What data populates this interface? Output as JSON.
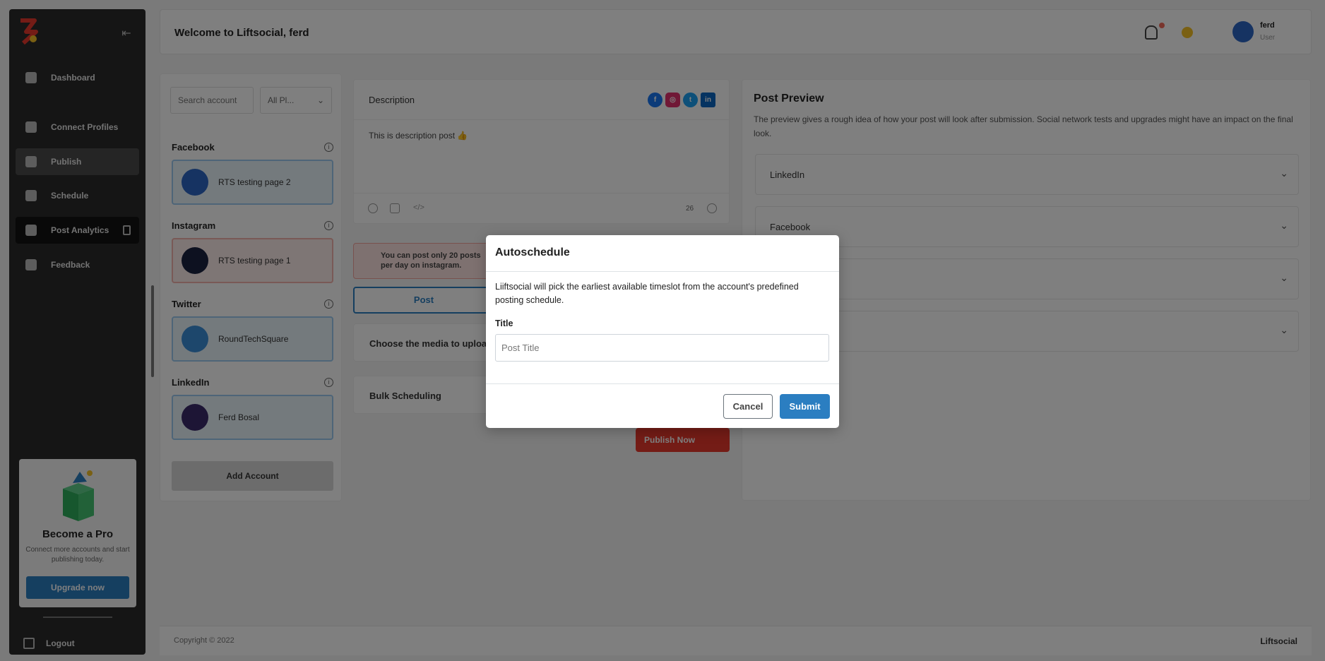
{
  "sidebar": {
    "items": [
      {
        "label": "Dashboard"
      },
      {
        "label": "Connect Profiles"
      },
      {
        "label": "Publish"
      },
      {
        "label": "Schedule"
      },
      {
        "label": "Post Analytics"
      },
      {
        "label": "Feedback"
      }
    ],
    "promo": {
      "title": "Become a Pro",
      "text": "Connect more accounts and start publishing today.",
      "button": "Upgrade now"
    },
    "logout": "Logout"
  },
  "header": {
    "welcome": "Welcome to Liftsocial, ferd",
    "user_name": "ferd",
    "user_role": "User"
  },
  "accounts": {
    "search_placeholder": "Search account",
    "filter_value": "All Pl...",
    "groups": [
      {
        "network": "Facebook",
        "account": "RTS testing page 2"
      },
      {
        "network": "Instagram",
        "account": "RTS testing page 1"
      },
      {
        "network": "Twitter",
        "account": "RoundTechSquare"
      },
      {
        "network": "LinkedIn",
        "account": "Ferd Bosal"
      }
    ],
    "add_button": "Add Account"
  },
  "compose": {
    "description_label": "Description",
    "description_text": "This is description post 👍",
    "char_count": "26",
    "warning": "You can post only 20 posts per day on instagram.",
    "post_tab": "Post",
    "media_label": "Choose the media to upload",
    "bulk_label": "Bulk Scheduling",
    "publish_button": "Publish Now"
  },
  "preview": {
    "title": "Post Preview",
    "subtitle": "The preview gives a rough idea of how your post will look after submission. Social network tests and upgrades might have an impact on the final look.",
    "rows": [
      "LinkedIn",
      "Facebook",
      "",
      ""
    ]
  },
  "footer": {
    "copyright": "Copyright © 2022",
    "brand": "Liftsocial"
  },
  "modal": {
    "title": "Autoschedule",
    "description": "Liiftsocial will pick the earliest available timeslot from the account's predefined posting schedule.",
    "field_label": "Title",
    "placeholder": "Post Title",
    "cancel": "Cancel",
    "submit": "Submit"
  },
  "colors": {
    "primary": "#2b7ec1",
    "danger": "#e8392c",
    "sidebar_bg": "#2a2a2a",
    "facebook": "#1877f2",
    "instagram": "#e1306c",
    "twitter": "#1da1f2",
    "linkedin": "#0a66c2"
  },
  "icons": [
    "logo-icon",
    "collapse-icon",
    "bell-icon",
    "theme-icon",
    "facebook-icon",
    "instagram-icon",
    "twitter-icon",
    "linkedin-icon",
    "info-icon",
    "emoji-icon",
    "image-icon",
    "code-icon",
    "chevron-down-icon",
    "logout-icon"
  ]
}
